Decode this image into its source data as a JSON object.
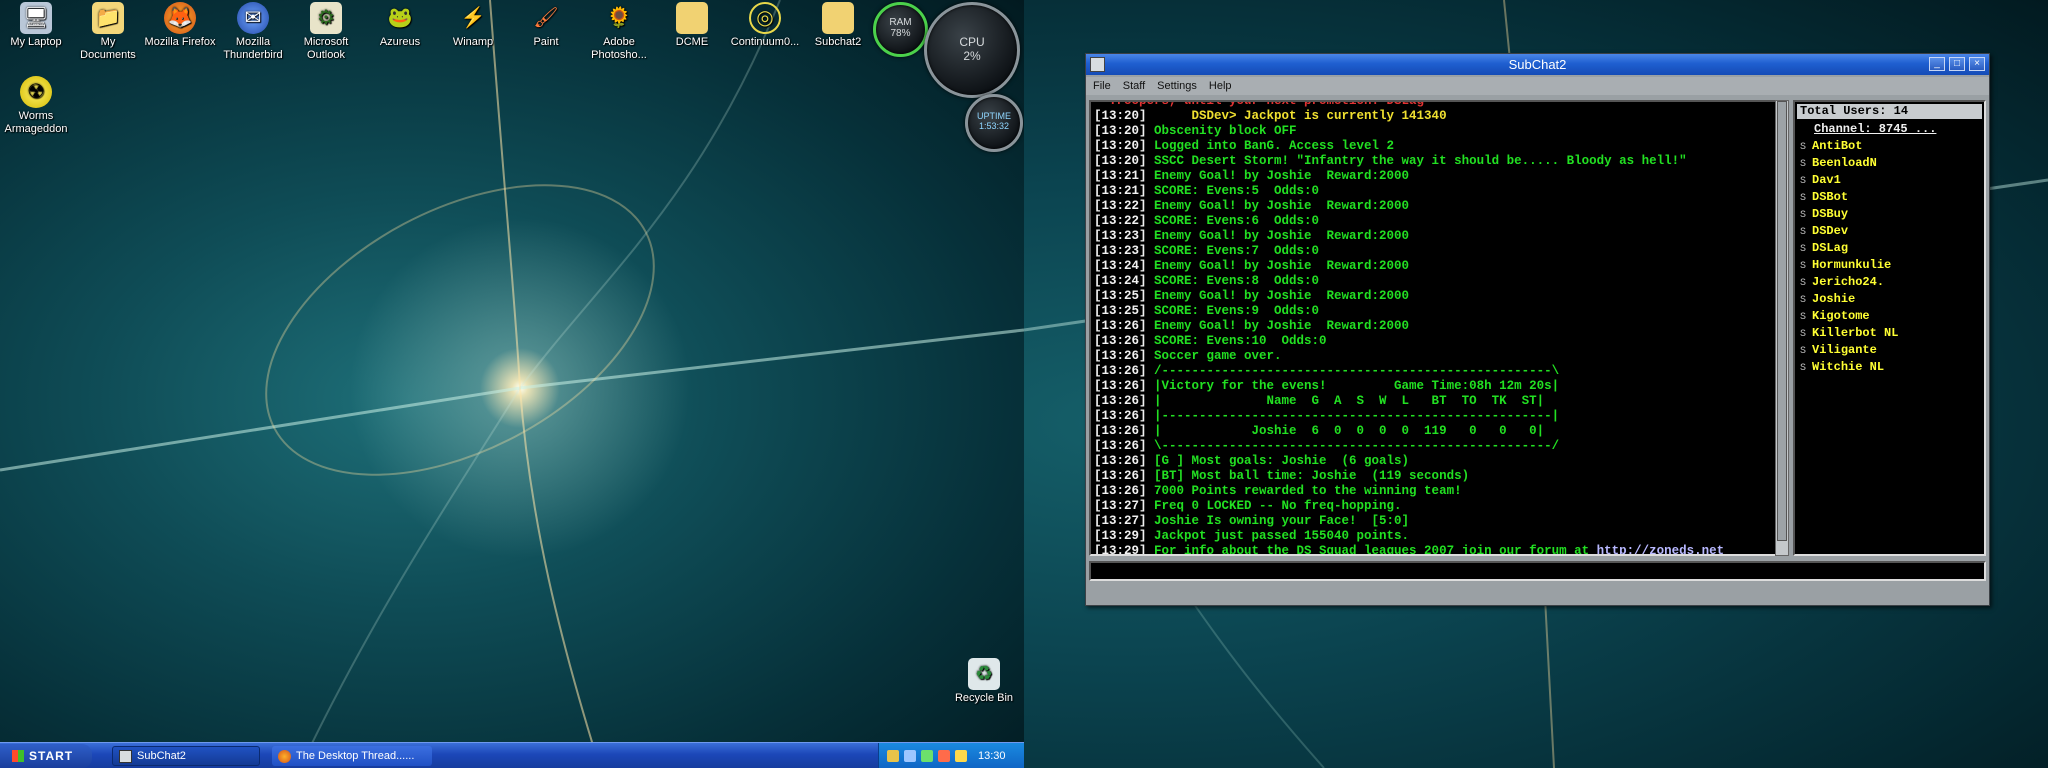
{
  "desktop_icons": [
    {
      "label": "My Laptop",
      "icon": "computer-icon"
    },
    {
      "label": "My Documents",
      "icon": "folder-documents-icon"
    },
    {
      "label": "Mozilla Firefox",
      "icon": "firefox-icon"
    },
    {
      "label": "Mozilla Thunderbird",
      "icon": "thunderbird-icon"
    },
    {
      "label": "Microsoft Outlook",
      "icon": "outlook-icon"
    },
    {
      "label": "Azureus",
      "icon": "azureus-icon"
    },
    {
      "label": "Winamp",
      "icon": "winamp-icon"
    },
    {
      "label": "Paint",
      "icon": "paint-icon"
    },
    {
      "label": "Adobe Photosho...",
      "icon": "photoshop-icon"
    },
    {
      "label": "DCME",
      "icon": "folder-icon"
    },
    {
      "label": "Continuum0...",
      "icon": "continuum-icon"
    },
    {
      "label": "Subchat2",
      "icon": "folder-icon"
    },
    {
      "label": "Worms Armageddon",
      "icon": "worms-icon"
    },
    {
      "label": "Recycle Bin",
      "icon": "recycle-bin-icon"
    }
  ],
  "gauges": {
    "ram_label": "RAM",
    "ram_value": "78%",
    "cpu_label": "CPU",
    "cpu_value": "2%",
    "uptime_label": "UPTIME",
    "uptime_value": "1:53:32"
  },
  "taskbar": {
    "start_label": "START",
    "tasks": [
      {
        "label": "SubChat2",
        "icon": "subchat-icon"
      },
      {
        "label": "The Desktop Thread......",
        "icon": "firefox-icon"
      }
    ],
    "clock": "13:30"
  },
  "window": {
    "title": "SubChat2",
    "menu": [
      "File",
      "Staff",
      "Settings",
      "Help"
    ],
    "chat_lines": [
      {
        "ts": "",
        "text": "  Troopers, until your next promotion. DSLag",
        "color": "red"
      },
      {
        "ts": "[13:20]",
        "text": "      DSDev> Jackpot is currently 141340",
        "color": "yellow"
      },
      {
        "ts": "[13:20]",
        "text": " Obscenity block OFF",
        "color": "green"
      },
      {
        "ts": "[13:20]",
        "text": " Logged into BanG. Access level 2",
        "color": "green"
      },
      {
        "ts": "[13:20]",
        "text": " SSCC Desert Storm! \"Infantry the way it should be..... Bloody as hell!\"",
        "color": "green"
      },
      {
        "ts": "[13:21]",
        "text": " Enemy Goal! by Joshie  Reward:2000",
        "color": "green"
      },
      {
        "ts": "[13:21]",
        "text": " SCORE: Evens:5  Odds:0",
        "color": "green"
      },
      {
        "ts": "[13:22]",
        "text": " Enemy Goal! by Joshie  Reward:2000",
        "color": "green"
      },
      {
        "ts": "[13:22]",
        "text": " SCORE: Evens:6  Odds:0",
        "color": "green"
      },
      {
        "ts": "[13:23]",
        "text": " Enemy Goal! by Joshie  Reward:2000",
        "color": "green"
      },
      {
        "ts": "[13:23]",
        "text": " SCORE: Evens:7  Odds:0",
        "color": "green"
      },
      {
        "ts": "[13:24]",
        "text": " Enemy Goal! by Joshie  Reward:2000",
        "color": "green"
      },
      {
        "ts": "[13:24]",
        "text": " SCORE: Evens:8  Odds:0",
        "color": "green"
      },
      {
        "ts": "[13:25]",
        "text": " Enemy Goal! by Joshie  Reward:2000",
        "color": "green"
      },
      {
        "ts": "[13:25]",
        "text": " SCORE: Evens:9  Odds:0",
        "color": "green"
      },
      {
        "ts": "[13:26]",
        "text": " Enemy Goal! by Joshie  Reward:2000",
        "color": "green"
      },
      {
        "ts": "[13:26]",
        "text": " SCORE: Evens:10  Odds:0",
        "color": "green"
      },
      {
        "ts": "[13:26]",
        "text": " Soccer game over.",
        "color": "green"
      },
      {
        "ts": "[13:26]",
        "text": " /----------------------------------------------------\\",
        "color": "green"
      },
      {
        "ts": "[13:26]",
        "text": " |Victory for the evens!         Game Time:08h 12m 20s|",
        "color": "green"
      },
      {
        "ts": "[13:26]",
        "text": " |              Name  G  A  S  W  L   BT  TO  TK  ST|",
        "color": "green"
      },
      {
        "ts": "[13:26]",
        "text": " |----------------------------------------------------|",
        "color": "green"
      },
      {
        "ts": "[13:26]",
        "text": " |            Joshie  6  0  0  0  0  119   0   0   0|",
        "color": "green"
      },
      {
        "ts": "[13:26]",
        "text": " \\----------------------------------------------------/",
        "color": "green"
      },
      {
        "ts": "[13:26]",
        "text": " [G ] Most goals: Joshie  (6 goals)",
        "color": "green"
      },
      {
        "ts": "[13:26]",
        "text": " [BT] Most ball time: Joshie  (119 seconds)",
        "color": "green"
      },
      {
        "ts": "[13:26]",
        "text": " 7000 Points rewarded to the winning team!",
        "color": "green"
      },
      {
        "ts": "[13:27]",
        "text": " Freq 0 LOCKED -- No freq-hopping.",
        "color": "green"
      },
      {
        "ts": "[13:27]",
        "text": " Joshie Is owning your Face!  [5:0]",
        "color": "green"
      },
      {
        "ts": "[13:29]",
        "text": " Jackpot just passed 155040 points.",
        "color": "green"
      },
      {
        "ts": "[13:29]",
        "text": " For info about the DS Squad leagues 2007 join our forum at ",
        "color": "green",
        "link": "http://zoneds.net"
      }
    ],
    "users_header": "Total Users: 14",
    "channel": "Channel: 8745    ...",
    "users": [
      "AntiBot",
      "BeenloadN",
      "Dav1",
      "DSBot",
      "DSBuy",
      "DSDev",
      "DSLag",
      "Hormunkulie",
      "Jericho24.",
      "Joshie",
      "Kigotome",
      "Killerbot NL",
      "Viligante",
      "Witchie NL"
    ],
    "user_flag": "S",
    "input_value": ""
  }
}
